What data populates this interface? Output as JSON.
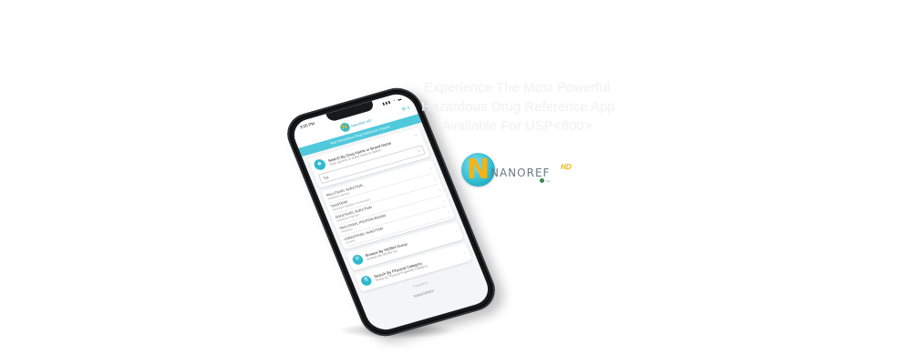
{
  "headline": {
    "line1": "Experience The Most Powerful",
    "line2": "Hazardous Drug Reference App",
    "line3": "Available For USP<800>"
  },
  "brand": {
    "letter": "N",
    "word": "NANOREF",
    "suffix": "HD",
    "tag": "by..."
  },
  "app": {
    "time": "3:05 PM",
    "status_icons": "▮▮▮ ◔ ▬",
    "header_logo_letter": "N",
    "header_logo_text": "NanoRef HD",
    "header_icons": "⚙ ≡",
    "banner": "Your Hazardous Drug Reference Source",
    "search": {
      "title": "Search By Drug Name or Brand Name",
      "subtitle": "Enter generic or brand name to search",
      "input_value": "Tax",
      "caret": "⌃"
    },
    "results": [
      {
        "title": "PACLITAXEL INJECTION",
        "subtitle": "Paclitaxel Injection"
      },
      {
        "title": "TAXOTERE",
        "subtitle": "Docetaxel Injection Concentrate"
      },
      {
        "title": "DOCETAXEL INJECTION",
        "subtitle": "Docetaxel Injection"
      },
      {
        "title": "PACLITAXEL PROTEIN-BOUND",
        "subtitle": "Abraxane"
      },
      {
        "title": "CABAZITAXEL INJECTION",
        "subtitle": "Jevtana"
      }
    ],
    "features": [
      {
        "title": "Browse By NIOSH Group",
        "subtitle": "Browse the NIOSH list"
      },
      {
        "title": "Search By Physical Category",
        "subtitle": "Group by Physical Properties Category"
      }
    ],
    "footer": {
      "line": "Powered by",
      "brand": "NANOREF"
    }
  }
}
